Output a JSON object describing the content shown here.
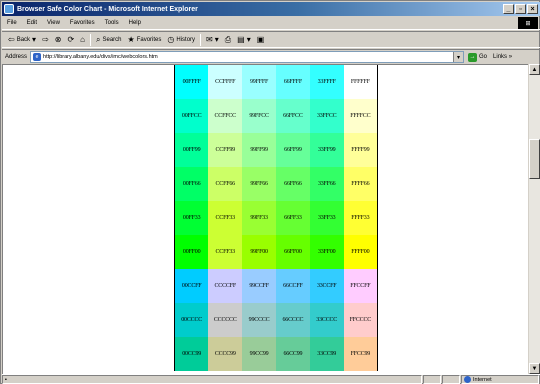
{
  "window": {
    "title": "Browser Safe Color Chart - Microsoft Internet Explorer"
  },
  "menu": [
    "File",
    "Edit",
    "View",
    "Favorites",
    "Tools",
    "Help"
  ],
  "toolbar": {
    "back": "Back",
    "search": "Search",
    "favorites": "Favorites",
    "history": "History"
  },
  "address": {
    "label": "Address",
    "url": "http://library.albany.edu/divs/imc/webcolors.htm",
    "go": "Go",
    "links": "Links"
  },
  "status": {
    "zone": "Internet"
  },
  "color_grid": [
    [
      "00FFFF",
      "CCFFFF",
      "99FFFF",
      "66FFFF",
      "33FFFF",
      "FFFFFF"
    ],
    [
      "00FFCC",
      "CCFFCC",
      "99FFCC",
      "66FFCC",
      "33FFCC",
      "FFFFCC"
    ],
    [
      "00FF99",
      "CCFF99",
      "99FF99",
      "66FF99",
      "33FF99",
      "FFFF99"
    ],
    [
      "00FF66",
      "CCFF66",
      "99FF66",
      "66FF66",
      "33FF66",
      "FFFF66"
    ],
    [
      "00FF33",
      "CCFF33",
      "99FF33",
      "66FF33",
      "33FF33",
      "FFFF33"
    ],
    [
      "00FF00",
      "CCFF33",
      "99FF00",
      "66FF00",
      "33FF00",
      "FFFF00"
    ],
    [
      "00CCFF",
      "CCCCFF",
      "99CCFF",
      "66CCFF",
      "33CCFF",
      "FFCCFF"
    ],
    [
      "00CCCC",
      "CCCCCC",
      "99CCCC",
      "66CCCC",
      "33CCCC",
      "FFCCCC"
    ],
    [
      "00CC99",
      "CCCC99",
      "99CC99",
      "66CC99",
      "33CC99",
      "FFCC99"
    ]
  ]
}
